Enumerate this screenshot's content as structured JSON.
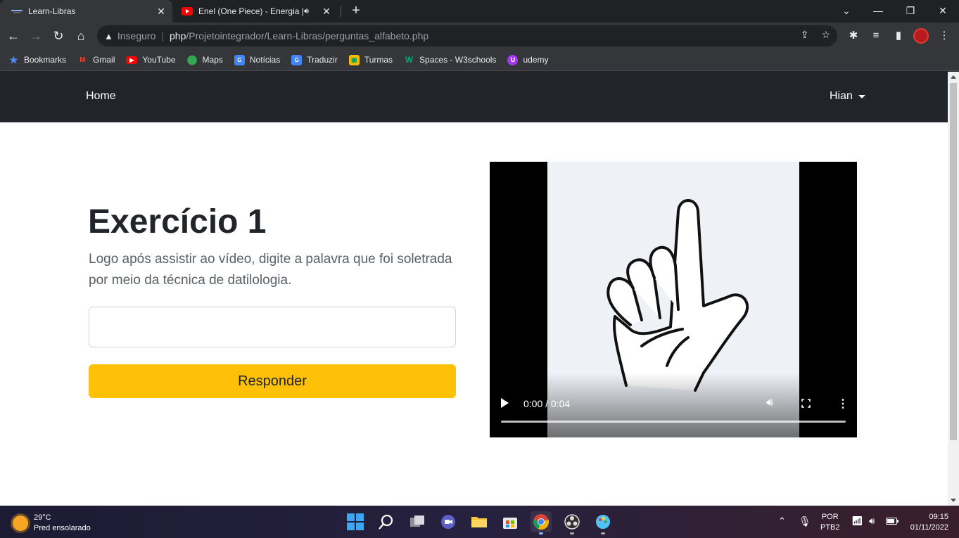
{
  "browser": {
    "tabs": [
      {
        "title": "Learn-Libras",
        "active": true
      },
      {
        "title": "Enel (One Piece) - Energia | M",
        "active": false,
        "audio": true
      }
    ],
    "security_label": "Inseguro",
    "url_host": "php",
    "url_path": "/Projetointegrador/Learn-Libras/perguntas_alfabeto.php",
    "bookmarks": [
      {
        "label": "Bookmarks",
        "icon": "star-icon",
        "color": "#4c8bf5"
      },
      {
        "label": "Gmail",
        "icon": "gmail-icon",
        "color": "#ea4335"
      },
      {
        "label": "YouTube",
        "icon": "youtube-icon",
        "color": "#ff0000"
      },
      {
        "label": "Maps",
        "icon": "maps-icon",
        "color": "#34a853"
      },
      {
        "label": "Notícias",
        "icon": "news-icon",
        "color": "#4285f4"
      },
      {
        "label": "Traduzir",
        "icon": "translate-icon",
        "color": "#4285f4"
      },
      {
        "label": "Turmas",
        "icon": "classroom-icon",
        "color": "#fbbc04"
      },
      {
        "label": "Spaces - W3schools",
        "icon": "w3schools-icon",
        "color": "#04aa6d"
      },
      {
        "label": "udemy",
        "icon": "udemy-icon",
        "color": "#a435f0"
      }
    ]
  },
  "site": {
    "nav_home": "Home",
    "nav_user": "Hian",
    "exercise_title": "Exercício 1",
    "exercise_description": "Logo após assistir ao vídeo, digite a palavra que foi soletrada por meio da técnica de datilologia.",
    "answer_value": "",
    "submit_label": "Responder",
    "video": {
      "time": "0:00 / 0:04",
      "progress": 0
    },
    "accent_color": "#ffc107",
    "nav_bg": "#212529"
  },
  "taskbar": {
    "weather_temp": "29°C",
    "weather_desc": "Pred ensolarado",
    "language_top": "POR",
    "language_bottom": "PTB2",
    "time": "09:15",
    "date": "01/11/2022"
  }
}
